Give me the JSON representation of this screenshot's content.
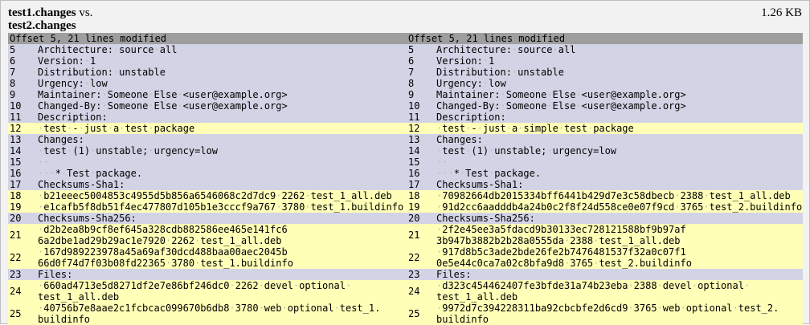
{
  "header": {
    "file1": "test1.changes",
    "vs": " vs.",
    "file2": "test2.changes",
    "size": "1.26 KB"
  },
  "left": {
    "offset_label": "Offset 5, 21 lines modified",
    "rows": [
      {
        "ln": "5",
        "type": "same",
        "lines": [
          [
            "Architecture:",
            ".",
            "source",
            ".",
            "all"
          ]
        ]
      },
      {
        "ln": "6",
        "type": "same",
        "lines": [
          [
            "Version:",
            ".",
            "1"
          ]
        ]
      },
      {
        "ln": "7",
        "type": "same",
        "lines": [
          [
            "Distribution:",
            ".",
            "unstable"
          ]
        ]
      },
      {
        "ln": "8",
        "type": "same",
        "lines": [
          [
            "Urgency:",
            ".",
            "low"
          ]
        ]
      },
      {
        "ln": "9",
        "type": "same",
        "lines": [
          [
            "Maintainer:",
            ".",
            "Someone",
            ".",
            "Else",
            ".",
            "<user@example.org>"
          ]
        ]
      },
      {
        "ln": "10",
        "type": "same",
        "lines": [
          [
            "Changed-By:",
            ".",
            "Someone",
            ".",
            "Else",
            ".",
            "<user@example.org>"
          ]
        ]
      },
      {
        "ln": "11",
        "type": "same",
        "lines": [
          [
            "Description:"
          ]
        ]
      },
      {
        "ln": "12",
        "type": "diff",
        "lines": [
          [
            ".",
            "test",
            ".",
            "-",
            ".",
            "just",
            ".",
            "a",
            ".",
            "test",
            ".",
            "package"
          ]
        ]
      },
      {
        "ln": "13",
        "type": "same",
        "lines": [
          [
            "Changes:"
          ]
        ]
      },
      {
        "ln": "14",
        "type": "same",
        "lines": [
          [
            ".",
            "test",
            ".",
            "(1)",
            ".",
            "unstable;",
            ".",
            "urgency=low"
          ]
        ]
      },
      {
        "ln": "15",
        "type": "same",
        "lines": [
          [
            ".",
            "."
          ]
        ]
      },
      {
        "ln": "16",
        "type": "same",
        "lines": [
          [
            "...",
            "*",
            ".",
            "Test",
            ".",
            "package."
          ]
        ]
      },
      {
        "ln": "17",
        "type": "same",
        "lines": [
          [
            "Checksums-Sha1:"
          ]
        ]
      },
      {
        "ln": "18",
        "type": "diff",
        "lines": [
          [
            ".",
            "b21eeec5004853c4955d5b856a6546068c2d7dc9",
            ".",
            "2262",
            ".",
            "test_1_all.deb"
          ]
        ]
      },
      {
        "ln": "19",
        "type": "diff",
        "lines": [
          [
            ".",
            "e1cafb5f8db51f4ec477807d105b1e3cccf9a767",
            ".",
            "3780",
            ".",
            "test_1.buildinfo"
          ]
        ]
      },
      {
        "ln": "20",
        "type": "same",
        "lines": [
          [
            "Checksums-Sha256:"
          ]
        ]
      },
      {
        "ln": "21",
        "type": "diff",
        "lines": [
          [
            ".",
            "d2b2ea8b9cf8ef645a328cdb882586ee465e141fc6"
          ],
          [
            "6a2dbe1ad29b29ac1e7920",
            ".",
            "2262",
            ".",
            "test_1_all.deb"
          ]
        ]
      },
      {
        "ln": "22",
        "type": "diff",
        "lines": [
          [
            ".",
            "167d989223978a45a69af30dcd488baa00aec2045b"
          ],
          [
            "66d0f74d7f03b08fd22365",
            ".",
            "3780",
            ".",
            "test_1.buildinfo"
          ]
        ]
      },
      {
        "ln": "23",
        "type": "same",
        "lines": [
          [
            "Files:"
          ]
        ]
      },
      {
        "ln": "24",
        "type": "diff",
        "lines": [
          [
            ".",
            "660ad4713e5d8271df2e7e86bf246dc0",
            ".",
            "2262",
            ".",
            "devel",
            ".",
            "optional",
            "."
          ],
          [
            "test_1_all.deb"
          ]
        ]
      },
      {
        "ln": "25",
        "type": "diff",
        "lines": [
          [
            ".",
            "40756b7e8aae2c1fcbcac099670b6db8",
            ".",
            "3780",
            ".",
            "web",
            ".",
            "optional",
            ".",
            "test_1."
          ],
          [
            "buildinfo"
          ]
        ]
      }
    ]
  },
  "right": {
    "offset_label": "Offset 5, 21 lines modified",
    "rows": [
      {
        "ln": "5",
        "type": "same",
        "lines": [
          [
            "Architecture:",
            ".",
            "source",
            ".",
            "all"
          ]
        ]
      },
      {
        "ln": "6",
        "type": "same",
        "lines": [
          [
            "Version:",
            ".",
            "1"
          ]
        ]
      },
      {
        "ln": "7",
        "type": "same",
        "lines": [
          [
            "Distribution:",
            ".",
            "unstable"
          ]
        ]
      },
      {
        "ln": "8",
        "type": "same",
        "lines": [
          [
            "Urgency:",
            ".",
            "low"
          ]
        ]
      },
      {
        "ln": "9",
        "type": "same",
        "lines": [
          [
            "Maintainer:",
            ".",
            "Someone",
            ".",
            "Else",
            ".",
            "<user@example.org>"
          ]
        ]
      },
      {
        "ln": "10",
        "type": "same",
        "lines": [
          [
            "Changed-By:",
            ".",
            "Someone",
            ".",
            "Else",
            ".",
            "<user@example.org>"
          ]
        ]
      },
      {
        "ln": "11",
        "type": "same",
        "lines": [
          [
            "Description:"
          ]
        ]
      },
      {
        "ln": "12",
        "type": "diff",
        "lines": [
          [
            ".",
            "test",
            ".",
            "-",
            ".",
            "just",
            ".",
            "a",
            ".",
            "simple",
            ".",
            "test",
            ".",
            "package"
          ]
        ]
      },
      {
        "ln": "13",
        "type": "same",
        "lines": [
          [
            "Changes:"
          ]
        ]
      },
      {
        "ln": "14",
        "type": "same",
        "lines": [
          [
            ".",
            "test",
            ".",
            "(1)",
            ".",
            "unstable;",
            ".",
            "urgency=low"
          ]
        ]
      },
      {
        "ln": "15",
        "type": "same",
        "lines": [
          [
            ".",
            "."
          ]
        ]
      },
      {
        "ln": "16",
        "type": "same",
        "lines": [
          [
            "...",
            "*",
            ".",
            "Test",
            ".",
            "package."
          ]
        ]
      },
      {
        "ln": "17",
        "type": "same",
        "lines": [
          [
            "Checksums-Sha1:"
          ]
        ]
      },
      {
        "ln": "18",
        "type": "diff",
        "lines": [
          [
            ".",
            "70982664db2015334bff6441b429d7e3c58dbecb",
            ".",
            "2388",
            ".",
            "test_1_all.deb"
          ]
        ]
      },
      {
        "ln": "19",
        "type": "diff",
        "lines": [
          [
            ".",
            "91d2cc6aadddb4a24b0c2f8f24d558ce0e07f9cd",
            ".",
            "3765",
            ".",
            "test_2.buildinfo"
          ]
        ]
      },
      {
        "ln": "20",
        "type": "same",
        "lines": [
          [
            "Checksums-Sha256:"
          ]
        ]
      },
      {
        "ln": "21",
        "type": "diff",
        "lines": [
          [
            ".",
            "2f2e45ee3a5fdacd9b30133ec728121588bf9b97af"
          ],
          [
            "3b947b3882b2b28a0555da",
            ".",
            "2388",
            ".",
            "test_1_all.deb"
          ]
        ]
      },
      {
        "ln": "22",
        "type": "diff",
        "lines": [
          [
            ".",
            "917d8b5c3ade2bde26fe2b7476481537f32a0c07f1"
          ],
          [
            "0e5e44c0ca7a02c8bfa9d8",
            ".",
            "3765",
            ".",
            "test_2.buildinfo"
          ]
        ]
      },
      {
        "ln": "23",
        "type": "same",
        "lines": [
          [
            "Files:"
          ]
        ]
      },
      {
        "ln": "24",
        "type": "diff",
        "lines": [
          [
            ".",
            "d323c454462407fe3bfde31a74b23eba",
            ".",
            "2388",
            ".",
            "devel",
            ".",
            "optional",
            "."
          ],
          [
            "test_1_all.deb"
          ]
        ]
      },
      {
        "ln": "25",
        "type": "diff",
        "lines": [
          [
            ".",
            "9972d7c394228311ba92cbcbfe2d6cd9",
            ".",
            "3765",
            ".",
            "web",
            ".",
            "optional",
            ".",
            "test_2."
          ],
          [
            "buildinfo"
          ]
        ]
      }
    ]
  }
}
